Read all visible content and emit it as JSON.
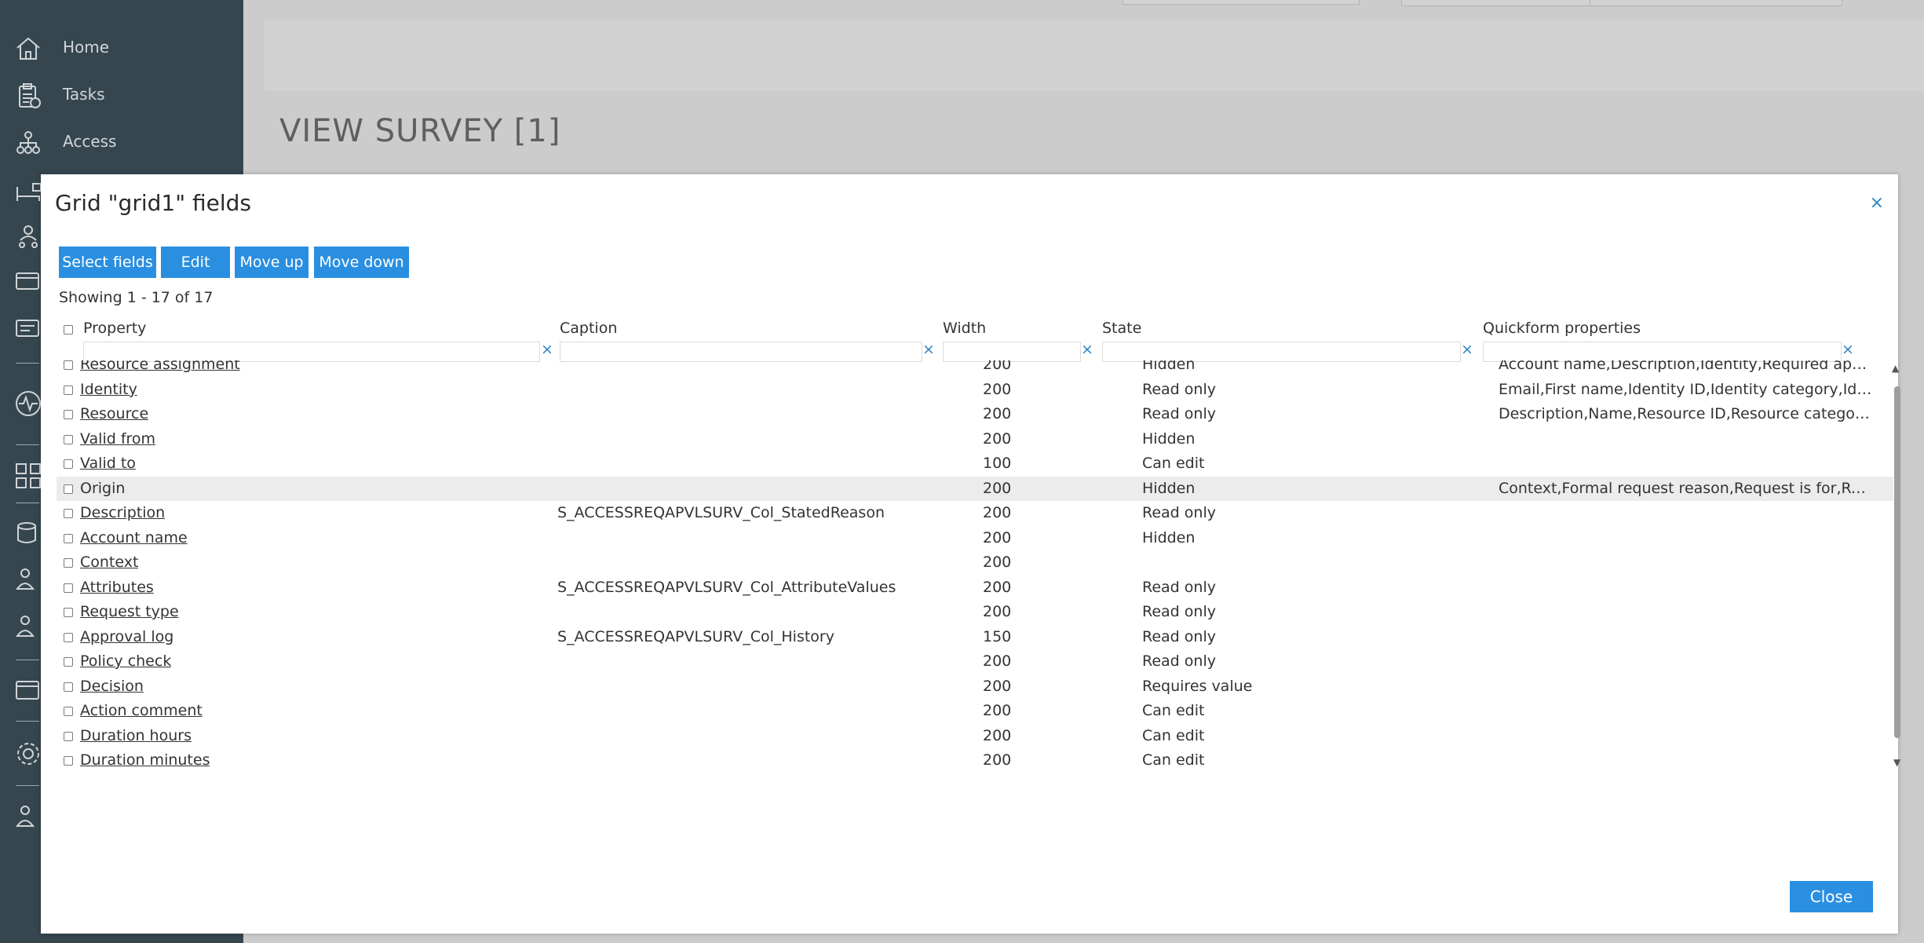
{
  "sidebar": {
    "items": [
      {
        "label": "Home",
        "icon": "home-icon"
      },
      {
        "label": "Tasks",
        "icon": "clipboard-icon"
      },
      {
        "label": "Access",
        "icon": "org-chart-icon"
      }
    ]
  },
  "background": {
    "page_title": "VIEW SURVEY [1]"
  },
  "modal": {
    "title": "Grid \"grid1\" fields",
    "close_icon": "×",
    "toolbar": {
      "select_fields": "Select fields",
      "edit": "Edit",
      "move_up": "Move up",
      "move_down": "Move down"
    },
    "showing": "Showing 1 - 17 of 17",
    "columns": {
      "property": "Property",
      "caption": "Caption",
      "width": "Width",
      "state": "State",
      "quickform": "Quickform properties"
    },
    "filter_clear": "×",
    "rows": [
      {
        "property": "Resource assignment",
        "caption": "",
        "width": "200",
        "state": "Hidden",
        "quick": "Account name,Description,Identity,Required appro…"
      },
      {
        "property": "Identity",
        "caption": "",
        "width": "200",
        "state": "Read only",
        "quick": "Email,First name,Identity ID,Identity category,Ident…"
      },
      {
        "property": "Resource",
        "caption": "",
        "width": "200",
        "state": "Read only",
        "quick": "Description,Name,Resource ID,Resource category,…"
      },
      {
        "property": "Valid from",
        "caption": "",
        "width": "200",
        "state": "Hidden",
        "quick": ""
      },
      {
        "property": "Valid to",
        "caption": "",
        "width": "100",
        "state": "Can edit",
        "quick": ""
      },
      {
        "property": "Origin",
        "caption": "",
        "width": "200",
        "state": "Hidden",
        "quick": "Context,Formal request reason,Request is for,Requ…"
      },
      {
        "property": "Description",
        "caption": "S_ACCESSREQAPVLSURV_Col_StatedReason",
        "width": "200",
        "state": "Read only",
        "quick": ""
      },
      {
        "property": "Account name",
        "caption": "",
        "width": "200",
        "state": "Hidden",
        "quick": ""
      },
      {
        "property": "Context",
        "caption": "",
        "width": "200",
        "state": "",
        "quick": ""
      },
      {
        "property": "Attributes",
        "caption": "S_ACCESSREQAPVLSURV_Col_AttributeValues",
        "width": "200",
        "state": "Read only",
        "quick": ""
      },
      {
        "property": "Request type",
        "caption": "",
        "width": "200",
        "state": "Read only",
        "quick": ""
      },
      {
        "property": "Approval log",
        "caption": "S_ACCESSREQAPVLSURV_Col_History",
        "width": "150",
        "state": "Read only",
        "quick": ""
      },
      {
        "property": "Policy check",
        "caption": "",
        "width": "200",
        "state": "Read only",
        "quick": ""
      },
      {
        "property": "Decision",
        "caption": "",
        "width": "200",
        "state": "Requires value",
        "quick": ""
      },
      {
        "property": "Action comment",
        "caption": "",
        "width": "200",
        "state": "Can edit",
        "quick": ""
      },
      {
        "property": "Duration hours",
        "caption": "",
        "width": "200",
        "state": "Can edit",
        "quick": ""
      },
      {
        "property": "Duration minutes",
        "caption": "",
        "width": "200",
        "state": "Can edit",
        "quick": ""
      }
    ],
    "close_button": "Close"
  }
}
